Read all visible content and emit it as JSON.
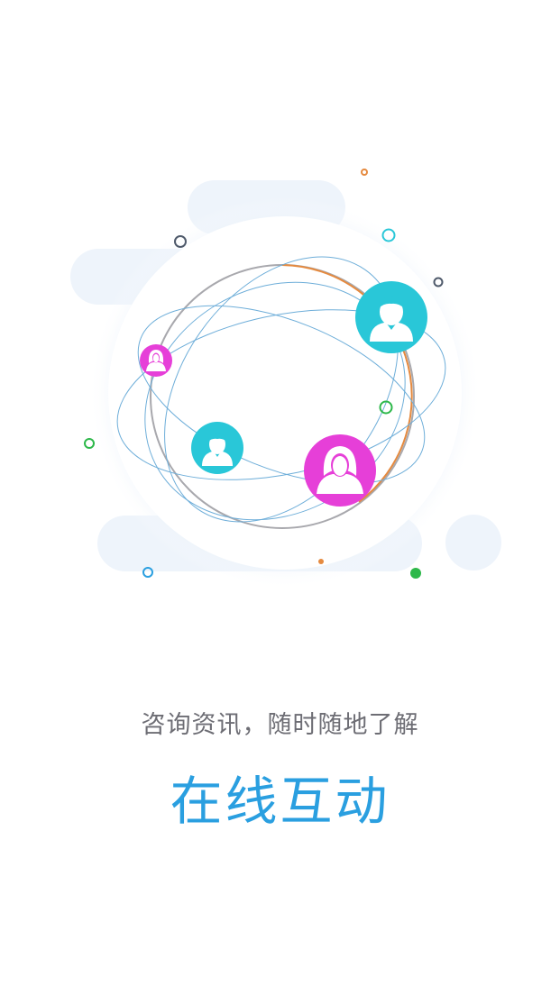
{
  "onboarding": {
    "subtitle": "咨询资讯，随时随地了解",
    "title": "在线互动"
  },
  "colors": {
    "accent_blue": "#2a9fe0",
    "teal": "#29c7d8",
    "magenta": "#e63fd8",
    "orange": "#e58a3f",
    "green": "#2db84a",
    "subtitle_gray": "#6d6d74"
  },
  "icons": [
    "male-avatar-icon",
    "female-avatar-icon"
  ]
}
